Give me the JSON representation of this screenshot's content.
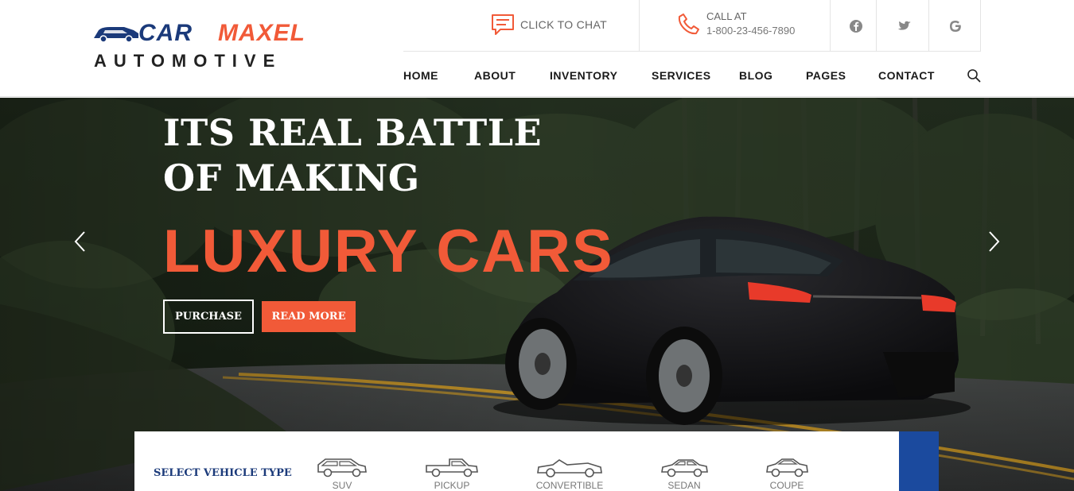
{
  "logo": {
    "word_a": "CAR",
    "word_b": "MAXEL",
    "sub": "AUTOMOTIVE"
  },
  "topbar": {
    "chat_label": "CLICK TO CHAT",
    "call_label": "CALL AT",
    "call_number": "1-800-23-456-7890",
    "social": [
      {
        "icon": "facebook-icon"
      },
      {
        "icon": "twitter-icon"
      },
      {
        "icon": "google-icon"
      }
    ]
  },
  "nav": {
    "items": [
      "HOME",
      "ABOUT",
      "INVENTORY",
      "SERVICES",
      "BLOG",
      "PAGES",
      "CONTACT"
    ]
  },
  "hero": {
    "title_line1": "ITS REAL BATTLE",
    "title_line2": "OF MAKING",
    "accent": "LUXURY CARS",
    "purchase_label": "PURCHASE",
    "read_more_label": "READ MORE"
  },
  "vehicle_types": {
    "label": "SELECT VEHICLE TYPE",
    "items": [
      "SUV",
      "PICKUP",
      "CONVERTIBLE",
      "SEDAN",
      "COUPE"
    ]
  },
  "colors": {
    "accent": "#f15a38",
    "brand_blue": "#1b3a7a",
    "panel_blue": "#1b4a9e"
  }
}
